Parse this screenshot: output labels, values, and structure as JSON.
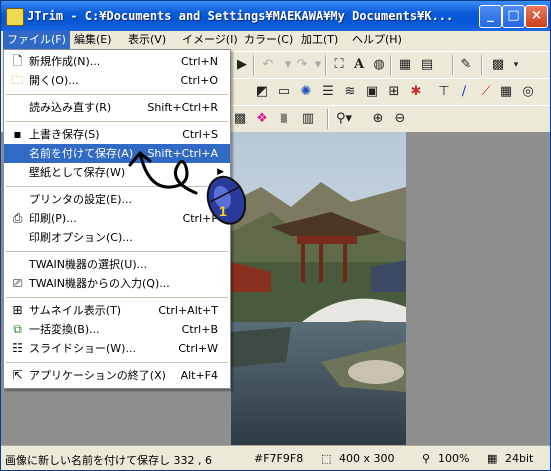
{
  "window": {
    "title": "JTrim - C:¥Documents and Settings¥MAEKAWA¥My Documents¥K...",
    "controls": [
      "_",
      "□",
      "×"
    ]
  },
  "menubar": {
    "items": [
      {
        "label": "ファイル(F)",
        "active": true
      },
      {
        "label": "編集(E)"
      },
      {
        "label": "表示(V)"
      },
      {
        "label": "イメージ(I)"
      },
      {
        "label": "カラー(C)"
      },
      {
        "label": "加工(T)"
      },
      {
        "label": "ヘルプ(H)"
      }
    ]
  },
  "file_menu": {
    "items": [
      {
        "label": "新規作成(N)...",
        "shortcut": "Ctrl+N",
        "icon": "new-file-icon"
      },
      {
        "label": "開く(O)...",
        "shortcut": "Ctrl+O",
        "icon": "open-folder-icon"
      },
      {
        "label": "読み込み直す(R)",
        "shortcut": "Shift+Ctrl+R"
      },
      {
        "label": "上書き保存(S)",
        "shortcut": "Ctrl+S",
        "icon": "save-icon"
      },
      {
        "label": "名前を付けて保存(A)",
        "shortcut": "Shift+Ctrl+A",
        "highlighted": true
      },
      {
        "label": "壁紙として保存(W)",
        "submenu": true
      },
      {
        "label": "プリンタの設定(E)..."
      },
      {
        "label": "印刷(P)...",
        "shortcut": "Ctrl+P",
        "icon": "printer-icon"
      },
      {
        "label": "印刷オプション(C)..."
      },
      {
        "label": "TWAIN機器の選択(U)..."
      },
      {
        "label": "TWAIN機器からの入力(Q)...",
        "icon": "scanner-icon"
      },
      {
        "label": "サムネイル表示(T)",
        "shortcut": "Ctrl+Alt+T",
        "icon": "thumbnail-icon"
      },
      {
        "label": "一括変換(B)...",
        "shortcut": "Ctrl+B",
        "icon": "batch-convert-icon"
      },
      {
        "label": "スライドショー(W)...",
        "shortcut": "Ctrl+W",
        "icon": "slideshow-icon"
      },
      {
        "label": "アプリケーションの終了(X)",
        "shortcut": "Alt+F4",
        "icon": "exit-icon"
      }
    ]
  },
  "cursor": {
    "label": "1"
  },
  "statusbar": {
    "message": "画像に新しい名前を付けて保存し 332 , 6",
    "color": "#F7F9F8",
    "size": "400 x 300",
    "zoom": "100%",
    "depth": "24bit"
  },
  "colors": {
    "title_bar": "#0a5ad9",
    "highlight": "#316ac5",
    "menu_bg": "#ece9d8"
  }
}
